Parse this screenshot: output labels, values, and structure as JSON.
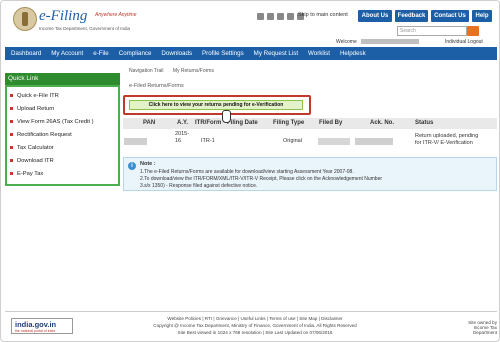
{
  "header": {
    "logo_main": "e-Filing",
    "logo_tagline": "Anywhere Anytime",
    "logo_department": "Income Tax Department, Government of India",
    "skip_link": "Skip to main content",
    "top_buttons": [
      "About Us",
      "Feedback",
      "Contact Us",
      "Help"
    ],
    "search_placeholder": "Search",
    "welcome_label": "Welcome",
    "user_type": "Individual  Logout"
  },
  "nav": {
    "items": [
      "Dashboard",
      "My Account",
      "e-File",
      "Compliance",
      "Downloads",
      "Profile Settings",
      "My Request List",
      "Worklist",
      "Helpdesk"
    ]
  },
  "sidebar": {
    "title": "Quick Link",
    "items": [
      "Quick e-File ITR",
      "Upload Return",
      "View Form 26AS (Tax Credit )",
      "Rectification Request",
      "Tax Calculator",
      "Download ITR",
      "E-Pay Tax"
    ]
  },
  "breadcrumbs": [
    "Navigation Trail",
    "My Returns/Forms"
  ],
  "main": {
    "section_title": "e-Filed Returns/Forms",
    "pending_button": "Click here to view your returns pending for e-Verification",
    "table": {
      "headers": [
        "PAN",
        "A.Y.",
        "ITR/Form",
        "Filing Date",
        "Filing Type",
        "Filed By",
        "Ack. No.",
        "Status"
      ],
      "row": {
        "ay_line1": "2015-",
        "ay_line2": "16",
        "itr": "ITR-1",
        "filing_type": "Original",
        "status_line1": "Return uploaded, pending",
        "status_line2": "for ITR-V/ E-Verification"
      }
    },
    "note": {
      "title": "Note :",
      "lines": [
        "1.The e-Filed Returns/Forms are available for download/view starting Assessment Year 2007-08.",
        "2.To download/view the ITR/FORM/XML/ITR-V/ITR-V Receipt, Please click on the Acknowledgement Number",
        "3.s/x 1350) - Response filed against defective notice."
      ]
    }
  },
  "footer": {
    "logo_text": "india.gov.in",
    "logo_sub": "the national portal of india",
    "links": "Website Policies  |  RTI  |  Grievance  |  Useful Links  |  Terms of use  |  Site Map  |  Disclaimer",
    "copyright": "Copyright @ Income Tax Department, Ministry of Finance, Government of India. All Rights Reserved",
    "best_viewed": "Site Best viewed in 1024 x 768 resolution | Site Last Updated on 07/06/2016",
    "maintained_line1": "Site owned by",
    "maintained_line2": "Income Tax Department"
  },
  "colors": {
    "brand_blue": "#1d5fa6",
    "quicklink_green": "#2e8b2e",
    "highlight_red": "#c0392b",
    "note_bg": "#eaf4fb"
  }
}
